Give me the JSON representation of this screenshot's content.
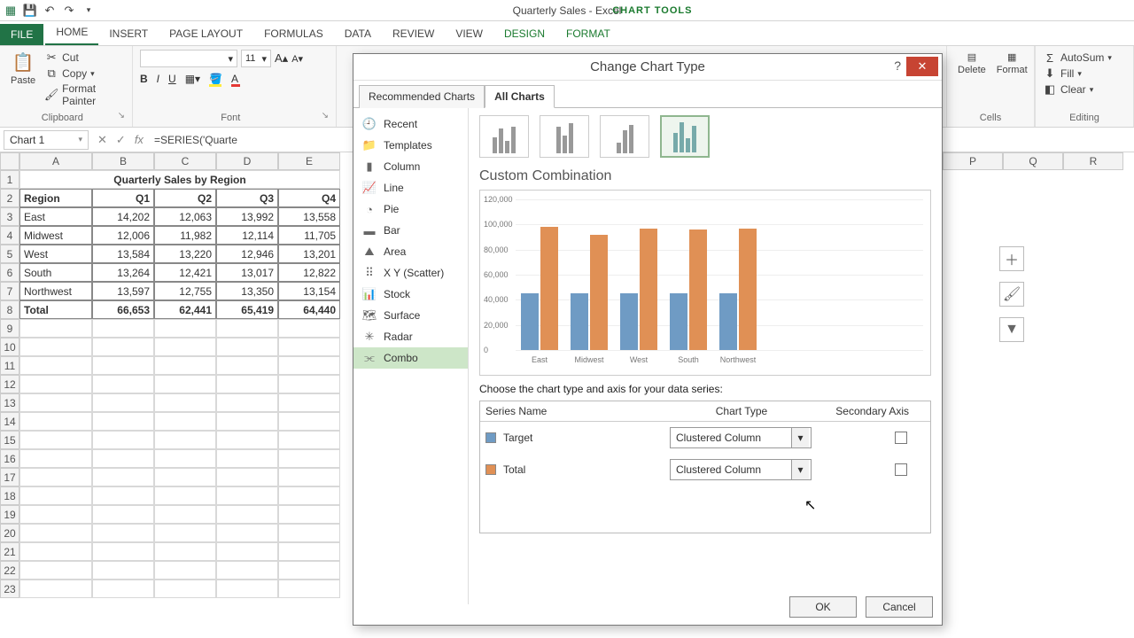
{
  "app": {
    "title": "Quarterly Sales - Excel",
    "chart_tools": "CHART TOOLS"
  },
  "tabs": {
    "file": "FILE",
    "home": "HOME",
    "insert": "INSERT",
    "pagelayout": "PAGE LAYOUT",
    "formulas": "FORMULAS",
    "data": "DATA",
    "review": "REVIEW",
    "view": "VIEW",
    "design": "DESIGN",
    "format": "FORMAT"
  },
  "ribbon": {
    "paste": "Paste",
    "cut": "Cut",
    "copy": "Copy",
    "fmtpainter": "Format Painter",
    "clipboard": "Clipboard",
    "font_group": "Font",
    "font_size": "11",
    "cells": "Cells",
    "formatbtn": "Format",
    "deletebtn": "Delete",
    "editing": "Editing",
    "autosum": "AutoSum",
    "fill": "Fill",
    "clear": "Clear"
  },
  "namebox": "Chart 1",
  "formula": "=SERIES('Quarte",
  "columns": [
    "A",
    "B",
    "C",
    "D",
    "E"
  ],
  "far_columns": [
    "P",
    "Q",
    "R"
  ],
  "rows": [
    "1",
    "2",
    "3",
    "4",
    "5",
    "6",
    "7",
    "8",
    "9",
    "10",
    "11",
    "12",
    "13",
    "14",
    "15",
    "16",
    "17",
    "18",
    "19",
    "20",
    "21",
    "22",
    "23"
  ],
  "table": {
    "title": "Quarterly Sales by Region",
    "headers": [
      "Region",
      "Q1",
      "Q2",
      "Q3",
      "Q4"
    ],
    "data": [
      [
        "East",
        "14,202",
        "12,063",
        "13,992",
        "13,558"
      ],
      [
        "Midwest",
        "12,006",
        "11,982",
        "12,114",
        "11,705"
      ],
      [
        "West",
        "13,584",
        "13,220",
        "12,946",
        "13,201"
      ],
      [
        "South",
        "13,264",
        "12,421",
        "13,017",
        "12,822"
      ],
      [
        "Northwest",
        "13,597",
        "12,755",
        "13,350",
        "13,154"
      ],
      [
        "Total",
        "66,653",
        "62,441",
        "65,419",
        "64,440"
      ]
    ]
  },
  "dialog": {
    "title": "Change Chart Type",
    "tab_rec": "Recommended Charts",
    "tab_all": "All Charts",
    "types": [
      "Recent",
      "Templates",
      "Column",
      "Line",
      "Pie",
      "Bar",
      "Area",
      "X Y (Scatter)",
      "Stock",
      "Surface",
      "Radar",
      "Combo"
    ],
    "subtitle": "Custom Combination",
    "y_ticks": [
      "0",
      "20,000",
      "40,000",
      "60,000",
      "80,000",
      "100,000",
      "120,000"
    ],
    "x_labels": [
      "East",
      "Midwest",
      "West",
      "South",
      "Northwest"
    ],
    "choose_label": "Choose the chart type and axis for your data series:",
    "col_series": "Series Name",
    "col_type": "Chart Type",
    "col_axis": "Secondary Axis",
    "series": [
      {
        "name": "Target",
        "type": "Clustered Column",
        "color": "#6f9bc4"
      },
      {
        "name": "Total",
        "type": "Clustered Column",
        "color": "#e09055"
      }
    ],
    "ok": "OK",
    "cancel": "Cancel"
  },
  "chart_data": {
    "type": "bar",
    "title": "Custom Combination",
    "categories": [
      "East",
      "Midwest",
      "West",
      "South",
      "Northwest"
    ],
    "series": [
      {
        "name": "Target",
        "values": [
          45000,
          45000,
          45000,
          45000,
          45000
        ]
      },
      {
        "name": "Total",
        "values": [
          98000,
          92000,
          97000,
          96000,
          97000
        ]
      }
    ],
    "ylim": [
      0,
      120000
    ],
    "ylabel": "",
    "xlabel": ""
  }
}
